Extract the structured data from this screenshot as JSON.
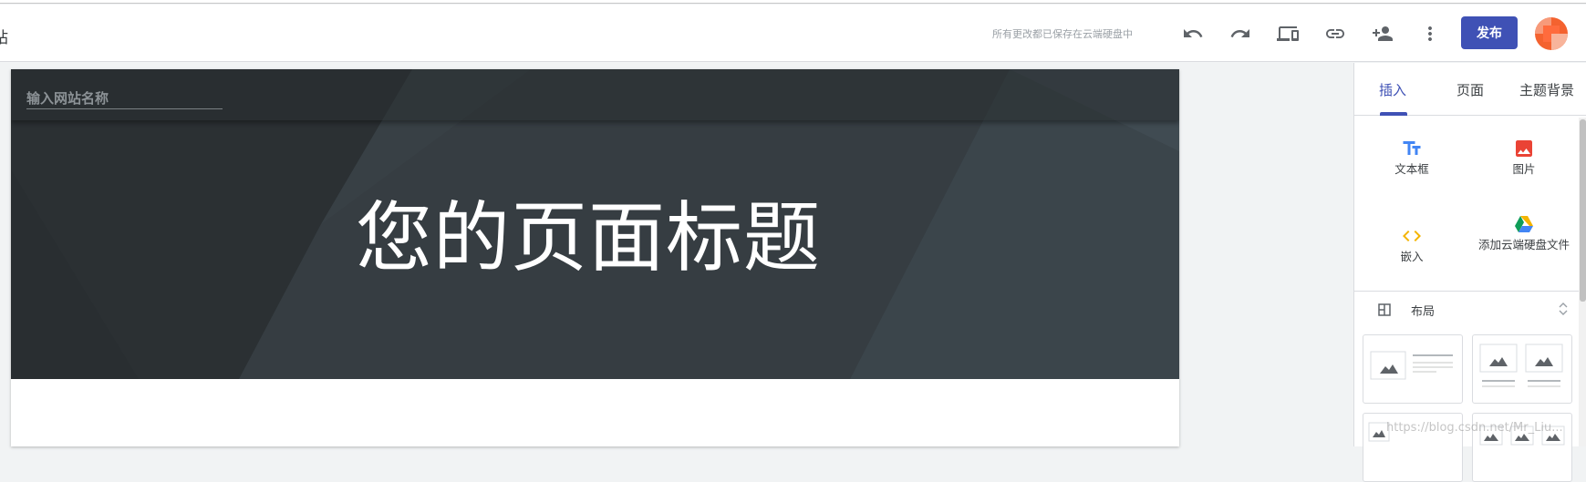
{
  "topbar": {
    "left_fragment": "站",
    "save_status": "所有更改都已保存在云端硬盘中",
    "publish_label": "发布",
    "icons": [
      "undo-icon",
      "redo-icon",
      "preview-devices-icon",
      "link-icon",
      "add-person-icon",
      "more-vert-icon"
    ]
  },
  "page": {
    "site_name_placeholder": "输入网站名称",
    "title": "您的页面标题"
  },
  "side_panel": {
    "tabs": [
      {
        "label": "插入",
        "active": true
      },
      {
        "label": "页面",
        "active": false
      },
      {
        "label": "主题背景",
        "active": false
      }
    ],
    "insert_items": [
      {
        "label": "文本框",
        "icon": "text-box-icon",
        "color": "#4285f4"
      },
      {
        "label": "图片",
        "icon": "image-icon",
        "color": "#ea4335"
      },
      {
        "label": "嵌入",
        "icon": "embed-icon",
        "color": "#f4b400"
      },
      {
        "label": "添加云端硬盘文件",
        "icon": "drive-icon",
        "color": "#0f9d58"
      }
    ],
    "layout_section": {
      "label": "布局",
      "icon": "layout-icon"
    }
  },
  "watermark": "https://blog.csdn.net/Mr_Liu..."
}
